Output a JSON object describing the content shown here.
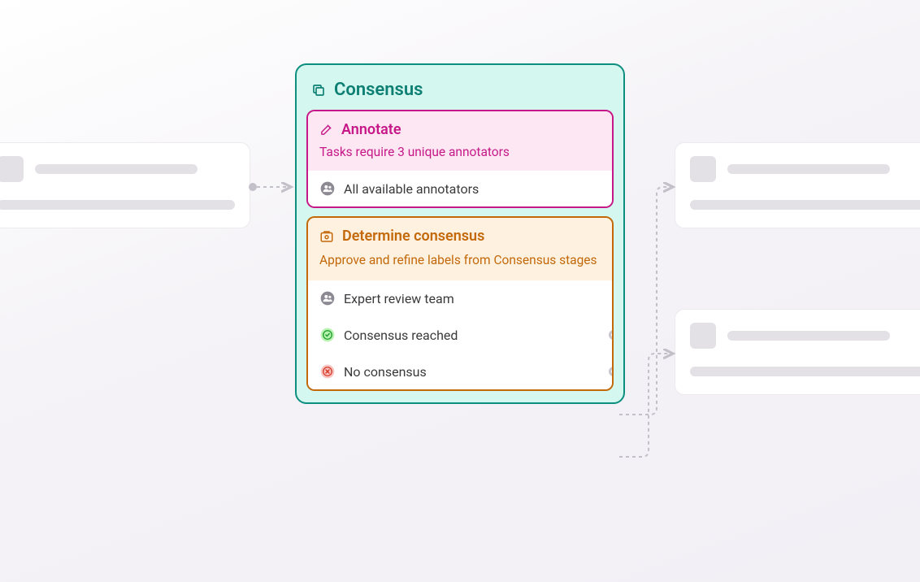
{
  "consensus": {
    "title": "Consensus",
    "annotate": {
      "title": "Annotate",
      "subtitle": "Tasks require 3 unique annotators",
      "assignee": "All available annotators"
    },
    "determine": {
      "title": "Determine consensus",
      "subtitle": "Approve and refine labels from Consensus stages",
      "assignee": "Expert review team",
      "outcomes": {
        "reached": "Consensus reached",
        "none": "No consensus"
      }
    }
  }
}
